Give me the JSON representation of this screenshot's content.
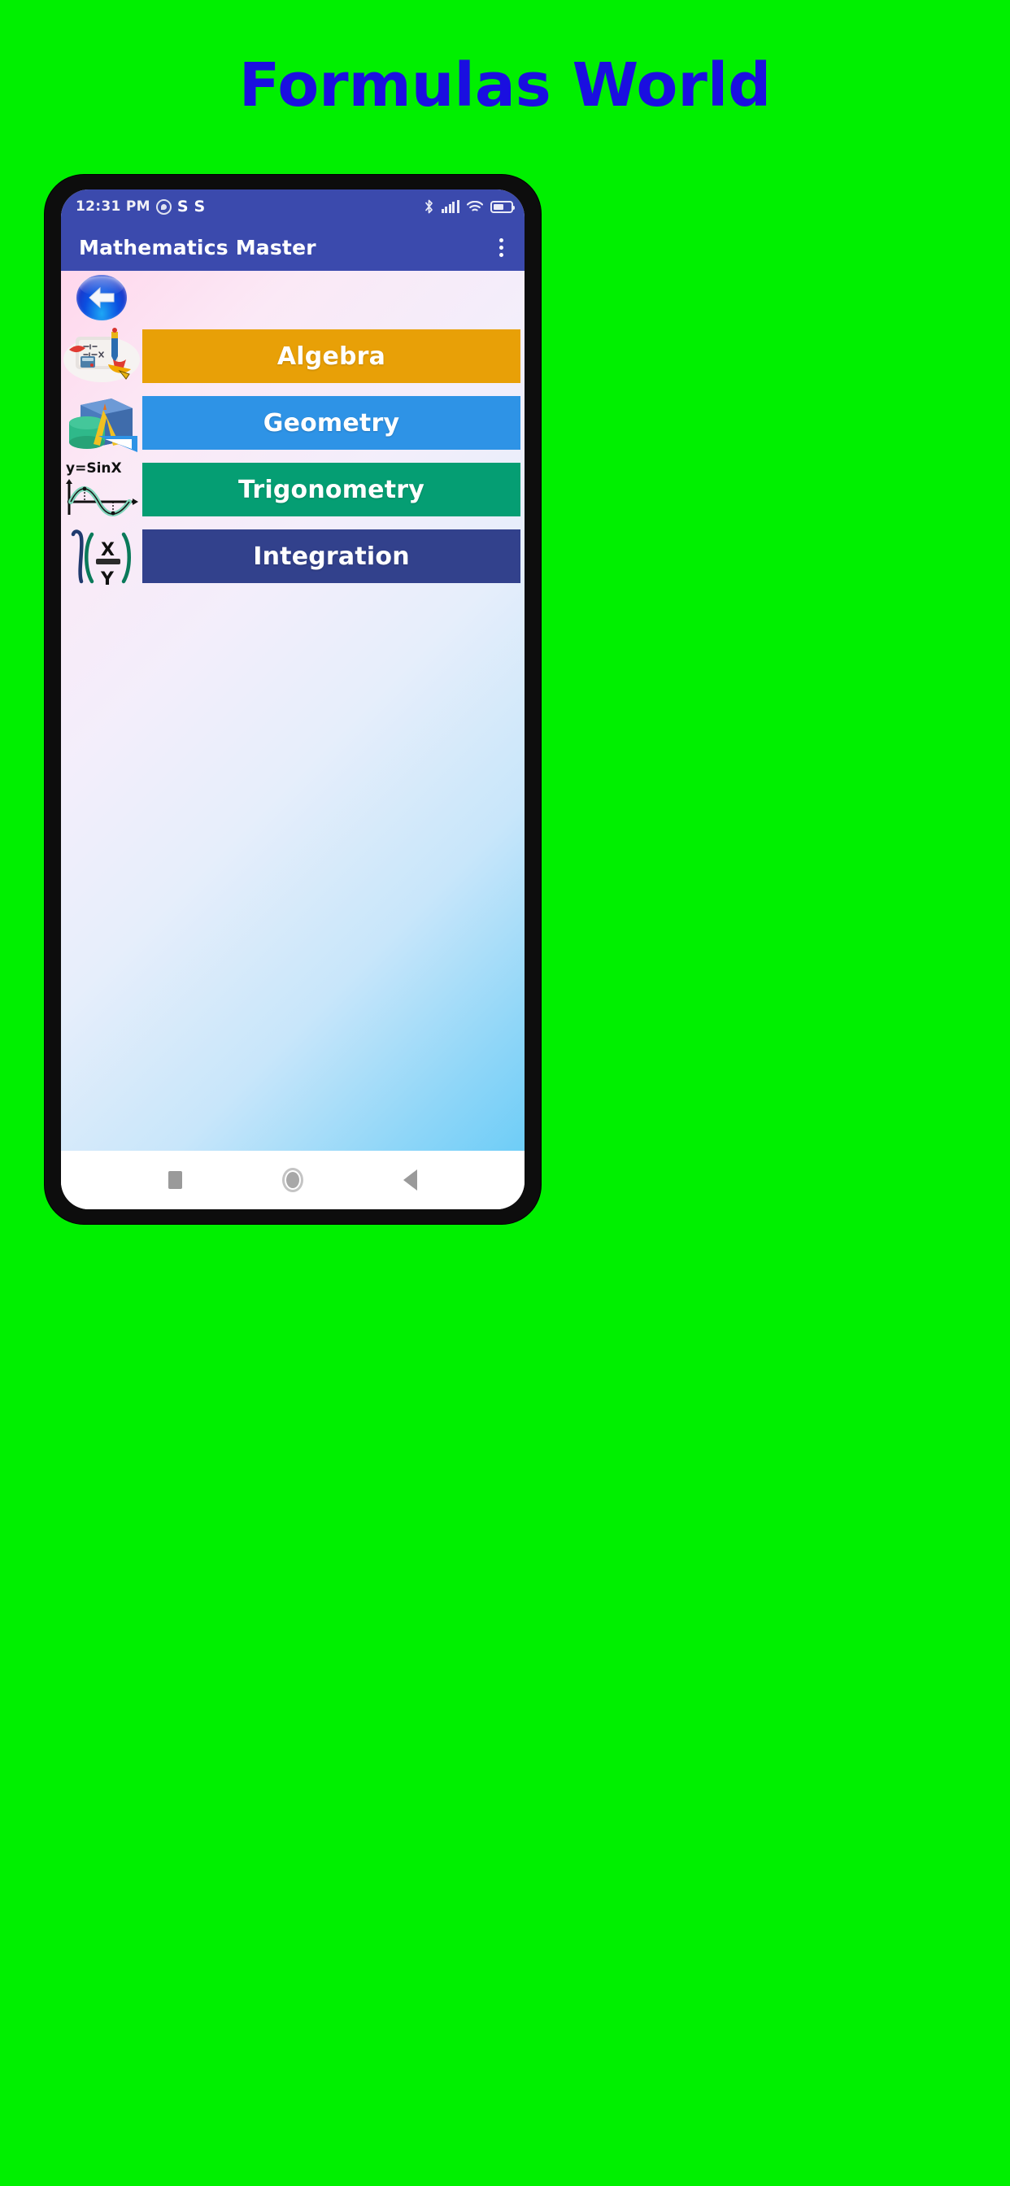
{
  "page": {
    "title": "Formulas World",
    "background_color": "#00f000",
    "title_color": "#1a0fe0"
  },
  "phone": {
    "status_bar": {
      "time": "12:31 PM",
      "left_icons": [
        "whatsapp-icon",
        "s-badge-icon",
        "s-badge-icon"
      ],
      "s_badge_1": "S",
      "s_badge_2": "S",
      "right_icons": [
        "bluetooth-icon",
        "signal-bars-icon",
        "wifi-icon",
        "battery-icon"
      ],
      "background_color": "#3b4aad"
    },
    "app_bar": {
      "title": "Mathematics Master",
      "overflow_icon": "kebab-menu-icon",
      "background_color": "#3b4aad"
    },
    "back_button": {
      "icon": "back-arrow-circle-icon"
    },
    "menu": {
      "items": [
        {
          "label": "Algebra",
          "color": "#e8a007",
          "icon": "algebra-icon"
        },
        {
          "label": "Geometry",
          "color": "#2e93e6",
          "icon": "geometry-icon"
        },
        {
          "label": "Trigonometry",
          "color": "#059e73",
          "icon": "trigonometry-icon"
        },
        {
          "label": "Integration",
          "color": "#32418c",
          "icon": "integration-icon"
        }
      ]
    },
    "trig_icon_label": "y=SinX",
    "integration_icon_numerator": "X",
    "integration_icon_denominator": "Y",
    "nav_bar": {
      "recents_icon": "square-recents-icon",
      "home_icon": "circle-home-icon",
      "back_icon": "triangle-back-icon"
    },
    "content_gradient": {
      "from": "#ffd7ec",
      "to": "#6ecdf7"
    }
  }
}
